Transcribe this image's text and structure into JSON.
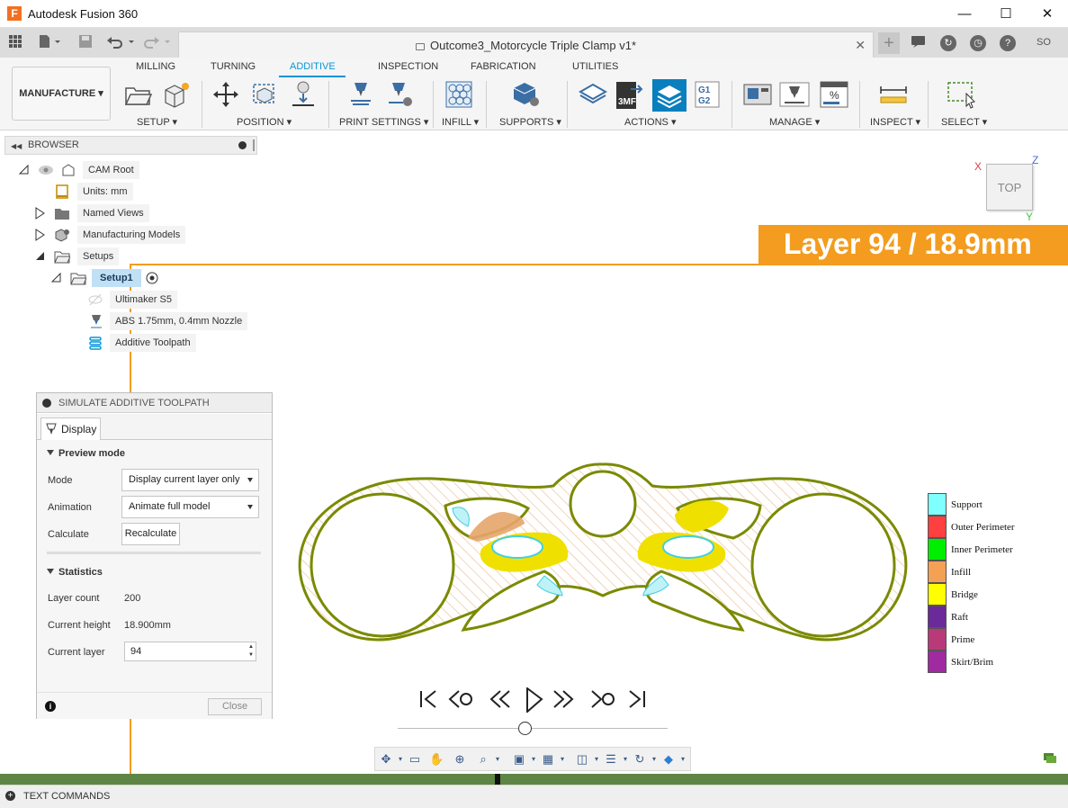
{
  "window": {
    "app_title": "Autodesk Fusion 360",
    "document_title": "Outcome3_Motorcycle Triple Clamp v1*",
    "user_initials": "SO"
  },
  "ribbon": {
    "workspace": "MANUFACTURE",
    "tabs": [
      "MILLING",
      "TURNING",
      "ADDITIVE",
      "INSPECTION",
      "FABRICATION",
      "UTILITIES"
    ],
    "active_tab": "ADDITIVE",
    "groups": [
      "SETUP",
      "POSITION",
      "PRINT SETTINGS",
      "INFILL",
      "SUPPORTS",
      "ACTIONS",
      "MANAGE",
      "INSPECT",
      "SELECT"
    ]
  },
  "browser": {
    "title": "BROWSER",
    "items": [
      {
        "label": "CAM Root"
      },
      {
        "label": "Units: mm"
      },
      {
        "label": "Named Views"
      },
      {
        "label": "Manufacturing Models"
      },
      {
        "label": "Setups"
      },
      {
        "label": "Setup1"
      },
      {
        "label": "Ultimaker S5"
      },
      {
        "label": "ABS 1.75mm, 0.4mm Nozzle"
      },
      {
        "label": "Additive Toolpath"
      }
    ]
  },
  "viewport": {
    "layer_banner": "Layer 94 / 18.9mm",
    "viewcube_face": "TOP",
    "axis_x": "X",
    "axis_y": "Y",
    "axis_z": "Z"
  },
  "sim_panel": {
    "title": "SIMULATE ADDITIVE TOOLPATH",
    "tab": "Display",
    "preview_section": "Preview mode",
    "mode_label": "Mode",
    "mode_value": "Display current layer only",
    "animation_label": "Animation",
    "animation_value": "Animate full model",
    "calculate_label": "Calculate",
    "recalculate_button": "Recalculate",
    "stats_section": "Statistics",
    "layer_count_label": "Layer count",
    "layer_count_value": "200",
    "current_height_label": "Current height",
    "current_height_value": "18.900mm",
    "current_layer_label": "Current layer",
    "current_layer_value": "94",
    "close_button": "Close"
  },
  "legend": [
    {
      "label": "Support",
      "color": "#80ffff"
    },
    {
      "label": "Outer Perimeter",
      "color": "#ff4040"
    },
    {
      "label": "Inner Perimeter",
      "color": "#00ee00"
    },
    {
      "label": "Infill",
      "color": "#f4a055"
    },
    {
      "label": "Bridge",
      "color": "#ffff00"
    },
    {
      "label": "Raft",
      "color": "#6a2a9a"
    },
    {
      "label": "Prime",
      "color": "#b83a78"
    },
    {
      "label": "Skirt/Brim",
      "color": "#a02aa0"
    }
  ],
  "playback": {
    "slider_fraction": 0.47
  },
  "text_commands": "TEXT COMMANDS",
  "colors": {
    "accent": "#0696d7",
    "banner": "#f39c1f",
    "timeline": "#5e8544",
    "part_outline": "#7a8a00"
  }
}
